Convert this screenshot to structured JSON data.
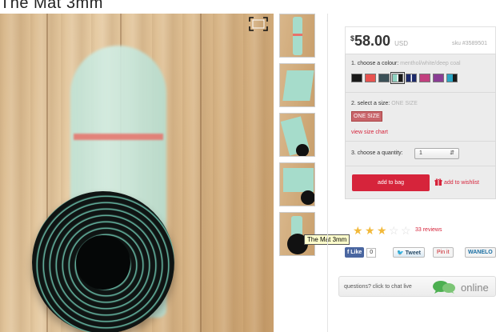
{
  "product": {
    "title": "The Mat 3mm"
  },
  "gallery": {
    "expand_icon": "expand-icon",
    "thumbnail_count": 5,
    "tooltip": "The Mat 3mm"
  },
  "purchase": {
    "currency_symbol": "$",
    "price": "58.00",
    "currency": "USD",
    "sku": "sku #3589501",
    "colour": {
      "label": "1. choose a colour:",
      "selected": "menthol/white/deep coal",
      "swatches": [
        "#1a1a1a",
        "#e8524f",
        "#3b5057",
        "#8fd3c2",
        "#1d2a6b",
        "#c2407f",
        "#8a3d94",
        "#2aa6c4"
      ]
    },
    "size": {
      "label": "2. select a size:",
      "selected": "ONE SIZE",
      "button": "ONE SIZE",
      "chart_link": "view size chart"
    },
    "quantity": {
      "label": "3. choose a quantity:",
      "value": "1"
    },
    "add_to_bag": "add to bag",
    "add_to_wishlist": "add to wishlist"
  },
  "rating": {
    "stars_filled": 3,
    "stars_total": 5,
    "reviews": "33 reviews"
  },
  "social": {
    "like": "Like",
    "like_count": "0",
    "tweet": "Tweet",
    "pin": "Pin it",
    "wanelo": "WANELO"
  },
  "chat": {
    "text": "questions? click to chat live",
    "status": "online"
  },
  "colors": {
    "accent": "#d6243b",
    "chat_icon": "#4caf50",
    "star": "#f2b93a"
  }
}
